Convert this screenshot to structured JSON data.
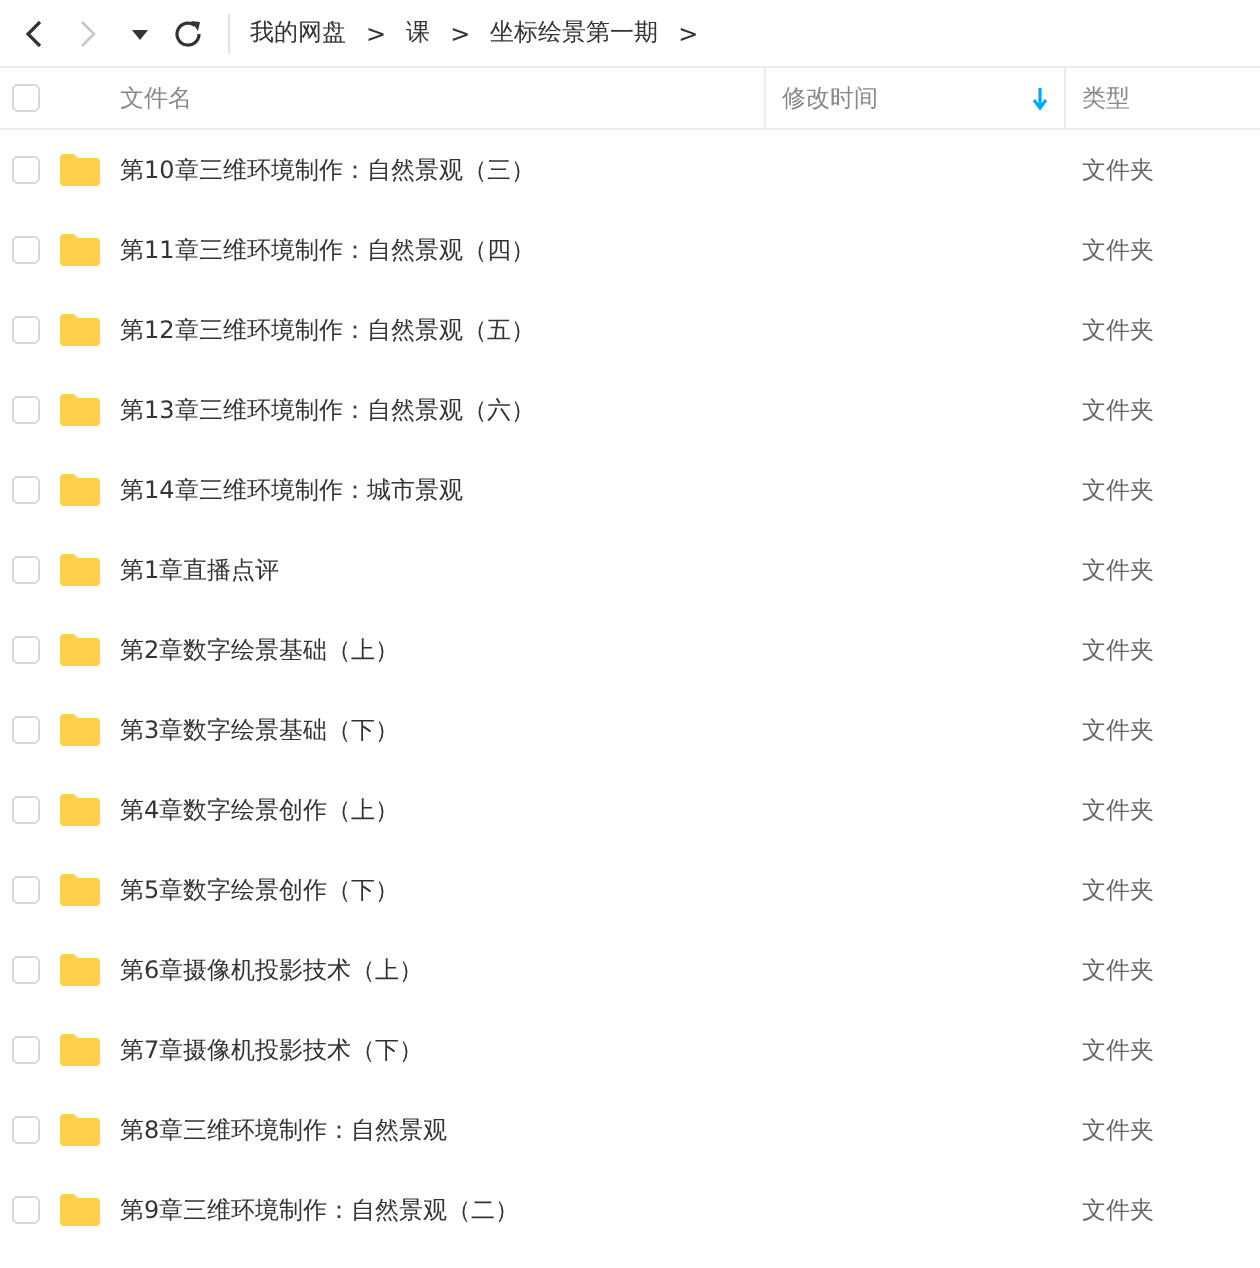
{
  "toolbar": {
    "nav": [
      {
        "kind": "back",
        "disabled": false
      },
      {
        "kind": "forward",
        "disabled": true
      },
      {
        "kind": "history",
        "disabled": false
      },
      {
        "kind": "refresh",
        "disabled": false
      }
    ],
    "breadcrumb": [
      {
        "label": "我的网盘",
        "separator": ">"
      },
      {
        "label": "课",
        "separator": ">"
      },
      {
        "label": "坐标绘景第一期",
        "separator": ">"
      }
    ]
  },
  "table": {
    "select_all": {
      "checked": false
    },
    "columns": [
      {
        "label": "文件名",
        "sorted": false
      },
      {
        "label": "修改时间",
        "sorted": true
      },
      {
        "label": "类型",
        "sorted": false
      }
    ],
    "rows": [
      {
        "name": "第10章三维环境制作：自然景观（三）",
        "type": "文件夹",
        "checked": false
      },
      {
        "name": "第11章三维环境制作：自然景观（四）",
        "type": "文件夹",
        "checked": false
      },
      {
        "name": "第12章三维环境制作：自然景观（五）",
        "type": "文件夹",
        "checked": false
      },
      {
        "name": "第13章三维环境制作：自然景观（六）",
        "type": "文件夹",
        "checked": false
      },
      {
        "name": "第14章三维环境制作：城市景观",
        "type": "文件夹",
        "checked": false
      },
      {
        "name": "第1章直播点评",
        "type": "文件夹",
        "checked": false
      },
      {
        "name": "第2章数字绘景基础（上）",
        "type": "文件夹",
        "checked": false
      },
      {
        "name": "第3章数字绘景基础（下）",
        "type": "文件夹",
        "checked": false
      },
      {
        "name": "第4章数字绘景创作（上）",
        "type": "文件夹",
        "checked": false
      },
      {
        "name": "第5章数字绘景创作（下）",
        "type": "文件夹",
        "checked": false
      },
      {
        "name": "第6章摄像机投影技术（上）",
        "type": "文件夹",
        "checked": false
      },
      {
        "name": "第7章摄像机投影技术（下）",
        "type": "文件夹",
        "checked": false
      },
      {
        "name": "第8章三维环境制作：自然景观",
        "type": "文件夹",
        "checked": false
      },
      {
        "name": "第9章三维环境制作：自然景观（二）",
        "type": "文件夹",
        "checked": false
      }
    ]
  }
}
